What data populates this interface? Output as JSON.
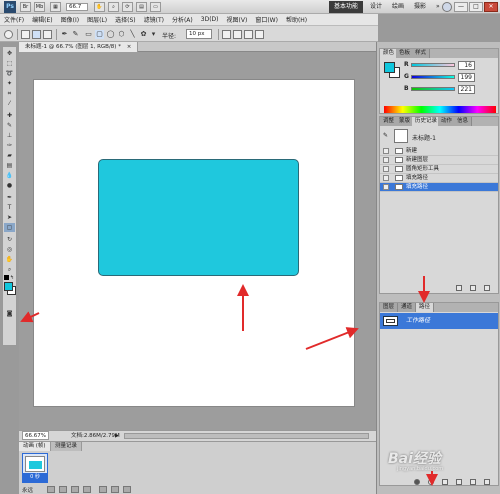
{
  "titlebar": {
    "logo": "Ps",
    "zoom_value": "66.7",
    "workspaces": [
      "基本功能",
      "设计",
      "绘画",
      "摄影"
    ],
    "more": "»",
    "window_buttons": [
      "—",
      "□",
      "✕"
    ]
  },
  "menu": [
    "文件(F)",
    "编辑(E)",
    "图像(I)",
    "图层(L)",
    "选择(S)",
    "滤镜(T)",
    "分析(A)",
    "3D(D)",
    "视图(V)",
    "窗口(W)",
    "帮助(H)"
  ],
  "options": {
    "feather_label": "半径:",
    "feather_value": "10 px"
  },
  "document": {
    "tab_title": "未标题-1 @ 66.7% (图层 1, RGB/8) *",
    "tab_close": "×",
    "zoom": "66.67%",
    "doc_info": "文档:2.86M/2.79M",
    "fill_color": "#1fc8dd"
  },
  "animation": {
    "tabs": [
      "动画 (帧)",
      "测量记录"
    ],
    "frame_time": "0 秒",
    "loop": "永远"
  },
  "color_panel": {
    "tabs": [
      "颜色",
      "色板",
      "样式"
    ],
    "r_label": "R",
    "g_label": "G",
    "b_label": "B",
    "r": "16",
    "g": "199",
    "b": "221",
    "fg_color": "#10c7dd"
  },
  "history_panel": {
    "tabs": [
      "调整",
      "蒙版",
      "历史记录",
      "动作",
      "信息"
    ],
    "snapshot": "未标题-1",
    "items": [
      "新建",
      "新建图层",
      "圆角矩形工具",
      "填充路径",
      "填充路径"
    ]
  },
  "layers_panel": {
    "tabs": [
      "图层",
      "通道",
      "路径"
    ],
    "path_name": "工作路径"
  },
  "toolbox_icons": [
    "move-tool",
    "marquee-tool",
    "lasso-tool",
    "quick-select-tool",
    "crop-tool",
    "eyedropper-tool",
    "healing-tool",
    "brush-tool",
    "clone-stamp-tool",
    "history-brush-tool",
    "eraser-tool",
    "gradient-tool",
    "blur-tool",
    "dodge-tool",
    "pen-tool",
    "type-tool",
    "path-select-tool",
    "rounded-rect-tool",
    "3d-rotate-tool",
    "3d-orbit-tool",
    "hand-tool",
    "zoom-tool"
  ],
  "watermark": {
    "text": "Bai经验",
    "sub": "jingyan.baidu.com"
  }
}
